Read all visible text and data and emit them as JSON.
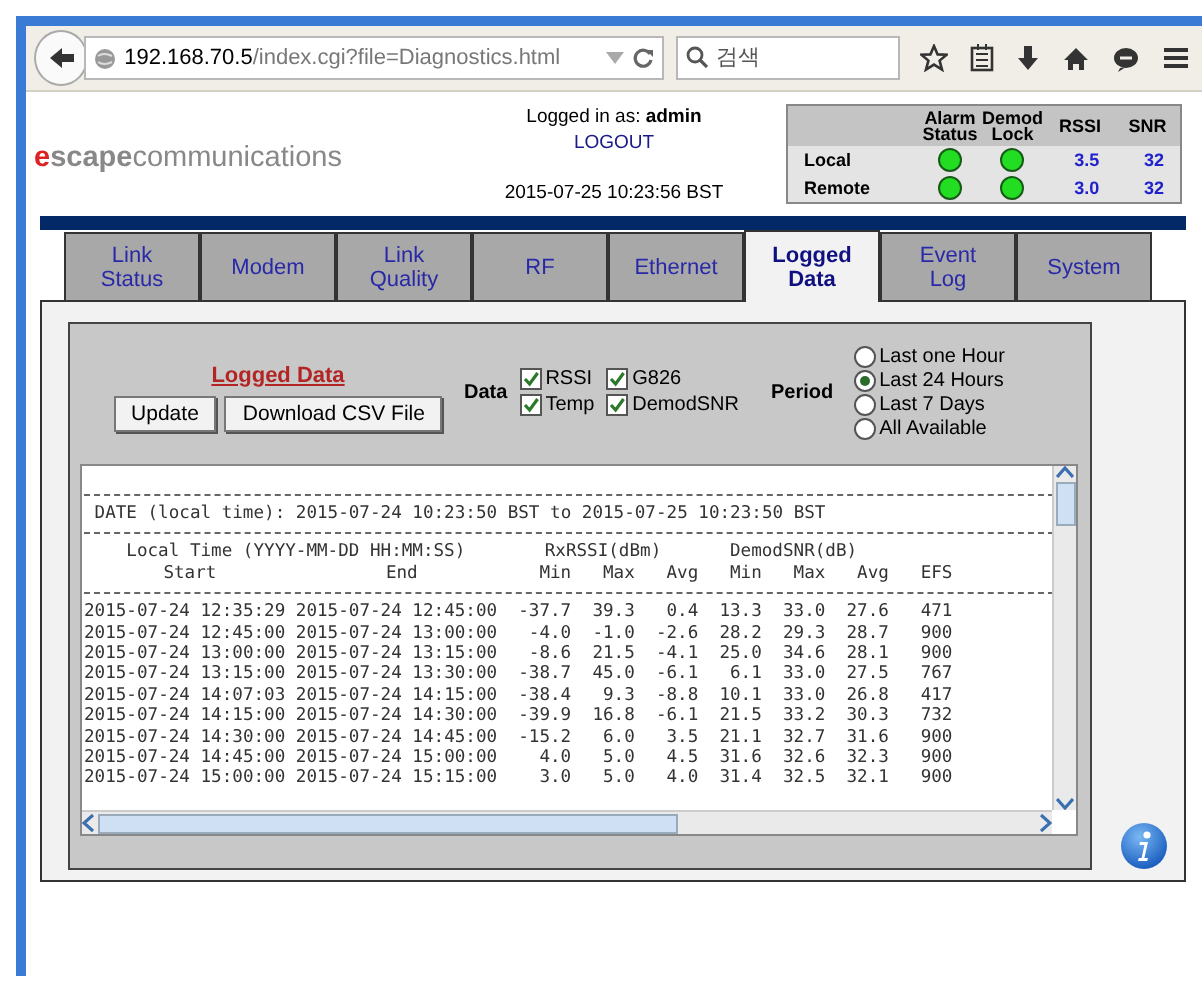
{
  "browser": {
    "url_host": "192.168.70.5",
    "url_path": "/index.cgi?file=Diagnostics.html",
    "search_placeholder": "검색"
  },
  "header": {
    "logo_accent": "e",
    "logo_bold": "scape",
    "logo_rest": "communications",
    "login_label": "Logged in as:",
    "user": "admin",
    "logout": "LOGOUT",
    "datetime": "2015-07-25 10:23:56 BST"
  },
  "status": {
    "columns": [
      "Alarm Status",
      "Demod Lock",
      "RSSI",
      "SNR"
    ],
    "rows": [
      {
        "name": "Local",
        "alarm_ok": true,
        "lock_ok": true,
        "rssi": "3.5",
        "snr": "32"
      },
      {
        "name": "Remote",
        "alarm_ok": true,
        "lock_ok": true,
        "rssi": "3.0",
        "snr": "32"
      }
    ]
  },
  "tabs": [
    {
      "label": "Link Status",
      "selected": false
    },
    {
      "label": "Modem",
      "selected": false
    },
    {
      "label": "Link Quality",
      "selected": false
    },
    {
      "label": "RF",
      "selected": false
    },
    {
      "label": "Ethernet",
      "selected": false
    },
    {
      "label": "Logged Data",
      "selected": true
    },
    {
      "label": "Event Log",
      "selected": false
    },
    {
      "label": "System",
      "selected": false
    }
  ],
  "panel": {
    "title": "Logged Data",
    "buttons": [
      "Update",
      "Download CSV File"
    ],
    "data_label": "Data",
    "data_options": [
      {
        "label": "RSSI",
        "checked": true
      },
      {
        "label": "G826",
        "checked": true
      },
      {
        "label": "Temp",
        "checked": true
      },
      {
        "label": "DemodSNR",
        "checked": true
      }
    ],
    "period_label": "Period",
    "periods": [
      {
        "label": "Last one Hour",
        "selected": false
      },
      {
        "label": "Last 24 Hours",
        "selected": true
      },
      {
        "label": "Last 7 Days",
        "selected": false
      },
      {
        "label": "All Available",
        "selected": false
      }
    ]
  },
  "log": {
    "range": "DATE (local time): 2015-07-24 10:23:50 BST to 2015-07-25 10:23:50 BST",
    "group_headers": [
      "Local Time (YYYY-MM-DD HH:MM:SS)",
      "RxRSSI(dBm)",
      "DemodSNR(dB)"
    ],
    "columns": [
      "Start",
      "End",
      "Min",
      "Max",
      "Avg",
      "Min",
      "Max",
      "Avg",
      "EFS"
    ],
    "rows": [
      [
        "2015-07-24 12:35:29",
        "2015-07-24 12:45:00",
        "-37.7",
        "39.3",
        "0.4",
        "13.3",
        "33.0",
        "27.6",
        "471"
      ],
      [
        "2015-07-24 12:45:00",
        "2015-07-24 13:00:00",
        "-4.0",
        "-1.0",
        "-2.6",
        "28.2",
        "29.3",
        "28.7",
        "900"
      ],
      [
        "2015-07-24 13:00:00",
        "2015-07-24 13:15:00",
        "-8.6",
        "21.5",
        "-4.1",
        "25.0",
        "34.6",
        "28.1",
        "900"
      ],
      [
        "2015-07-24 13:15:00",
        "2015-07-24 13:30:00",
        "-38.7",
        "45.0",
        "-6.1",
        "6.1",
        "33.0",
        "27.5",
        "767"
      ],
      [
        "2015-07-24 14:07:03",
        "2015-07-24 14:15:00",
        "-38.4",
        "9.3",
        "-8.8",
        "10.1",
        "33.0",
        "26.8",
        "417"
      ],
      [
        "2015-07-24 14:15:00",
        "2015-07-24 14:30:00",
        "-39.9",
        "16.8",
        "-6.1",
        "21.5",
        "33.2",
        "30.3",
        "732"
      ],
      [
        "2015-07-24 14:30:00",
        "2015-07-24 14:45:00",
        "-15.2",
        "6.0",
        "3.5",
        "21.1",
        "32.7",
        "31.6",
        "900"
      ],
      [
        "2015-07-24 14:45:00",
        "2015-07-24 15:00:00",
        "4.0",
        "5.0",
        "4.5",
        "31.6",
        "32.6",
        "32.3",
        "900"
      ],
      [
        "2015-07-24 15:00:00",
        "2015-07-24 15:15:00",
        "3.0",
        "5.0",
        "4.0",
        "31.4",
        "32.5",
        "32.1",
        "900"
      ]
    ]
  }
}
